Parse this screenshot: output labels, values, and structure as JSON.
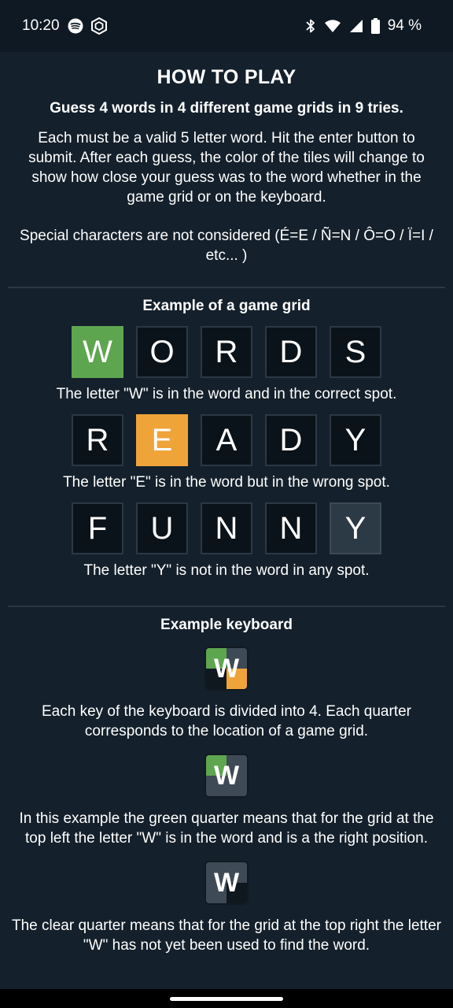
{
  "status_bar": {
    "time": "10:20",
    "left_icons": [
      "spotify-icon",
      "hexagon-app-icon"
    ],
    "right_icons": [
      "bluetooth-icon",
      "wifi-icon",
      "signal-icon",
      "battery-icon"
    ],
    "battery": "94 %"
  },
  "help": {
    "title": "HOW TO PLAY",
    "subtitle": "Guess 4 words in 4 different game grids in 9 tries.",
    "intro": "Each must be a valid 5 letter word. Hit the enter button to submit. After each guess, the color of the tiles will change to show how close your guess was to the word whether in the game grid or on the keyboard.",
    "special_chars": "Special characters are not considered (É=E / Ñ=N / Ô=O / Ï=I / etc... )"
  },
  "grid_example": {
    "title": "Example of a game grid",
    "rows": [
      {
        "tiles": [
          {
            "letter": "W",
            "state": "correct"
          },
          {
            "letter": "O",
            "state": "empty"
          },
          {
            "letter": "R",
            "state": "empty"
          },
          {
            "letter": "D",
            "state": "empty"
          },
          {
            "letter": "S",
            "state": "empty"
          }
        ],
        "caption": "The letter \"W\" is in the word and in the correct spot."
      },
      {
        "tiles": [
          {
            "letter": "R",
            "state": "empty"
          },
          {
            "letter": "E",
            "state": "present"
          },
          {
            "letter": "A",
            "state": "empty"
          },
          {
            "letter": "D",
            "state": "empty"
          },
          {
            "letter": "Y",
            "state": "empty"
          }
        ],
        "caption": "The letter \"E\" is in the word but in the wrong spot."
      },
      {
        "tiles": [
          {
            "letter": "F",
            "state": "empty"
          },
          {
            "letter": "U",
            "state": "empty"
          },
          {
            "letter": "N",
            "state": "empty"
          },
          {
            "letter": "N",
            "state": "empty"
          },
          {
            "letter": "Y",
            "state": "absent"
          }
        ],
        "caption": "The letter \"Y\" is not in the word in any spot."
      }
    ]
  },
  "keyboard_example": {
    "title": "Example keyboard",
    "keys": [
      {
        "letter": "W",
        "quarters": {
          "tl": "green",
          "tr": "grey",
          "bl": "dark",
          "br": "orange"
        },
        "caption": "Each key of the keyboard is divided into 4. Each quarter corresponds to the location of a game grid."
      },
      {
        "letter": "W",
        "quarters": {
          "tl": "green",
          "tr": "grey",
          "bl": "grey",
          "br": "grey"
        },
        "caption": "In this example the green quarter means that for the grid at the top left the letter \"W\" is in the word and is a the right position."
      },
      {
        "letter": "W",
        "quarters": {
          "tl": "grey",
          "tr": "grey",
          "bl": "grey",
          "br": "dark"
        },
        "caption": "The clear quarter means that for the grid at the top right the letter \"W\" has not yet been used to find the word."
      }
    ]
  },
  "colors": {
    "background": "#14202b",
    "correct": "#5ea54f",
    "present": "#efa43a",
    "absent": "#2c3a46"
  }
}
